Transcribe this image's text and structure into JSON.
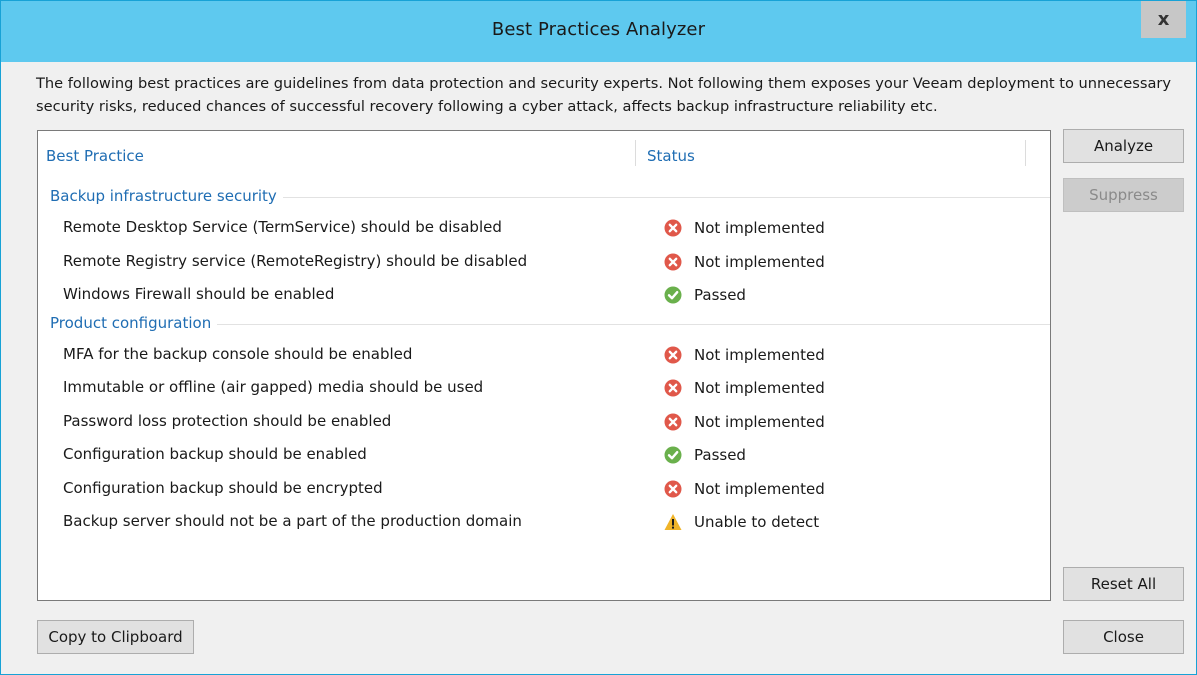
{
  "window": {
    "title": "Best Practices Analyzer",
    "close_glyph": "x"
  },
  "description": "The following best practices are guidelines from data protection and security experts. Not following them exposes your Veeam deployment to unnecessary security risks, reduced chances of successful recovery following a cyber attack, affects backup infrastructure reliability etc.",
  "table": {
    "columns": [
      "Best Practice",
      "Status"
    ],
    "groups": [
      {
        "name": "Backup infrastructure security",
        "items": [
          {
            "practice": "Remote Desktop Service (TermService) should be disabled",
            "status": "Not implemented",
            "icon": "error-icon"
          },
          {
            "practice": "Remote Registry service (RemoteRegistry) should be disabled",
            "status": "Not implemented",
            "icon": "error-icon"
          },
          {
            "practice": "Windows Firewall should be enabled",
            "status": "Passed",
            "icon": "check-icon"
          }
        ]
      },
      {
        "name": "Product configuration",
        "items": [
          {
            "practice": "MFA for the backup console should be enabled",
            "status": "Not implemented",
            "icon": "error-icon"
          },
          {
            "practice": "Immutable or offline (air gapped) media should be used",
            "status": "Not implemented",
            "icon": "error-icon"
          },
          {
            "practice": "Password loss protection should be enabled",
            "status": "Not implemented",
            "icon": "error-icon"
          },
          {
            "practice": "Configuration backup should be enabled",
            "status": "Passed",
            "icon": "check-icon"
          },
          {
            "practice": "Configuration backup should be encrypted",
            "status": "Not implemented",
            "icon": "error-icon"
          },
          {
            "practice": "Backup server should not be a part of the production domain",
            "status": "Unable to detect",
            "icon": "warning-icon"
          }
        ]
      }
    ]
  },
  "buttons": {
    "analyze": "Analyze",
    "suppress": "Suppress",
    "reset_all": "Reset All",
    "copy": "Copy to Clipboard",
    "close": "Close"
  },
  "colors": {
    "titlebar": "#5ec9ef",
    "header_text": "#1f6db3",
    "error": "#e0584a",
    "passed": "#6ab04c",
    "warning": "#f0b429"
  }
}
